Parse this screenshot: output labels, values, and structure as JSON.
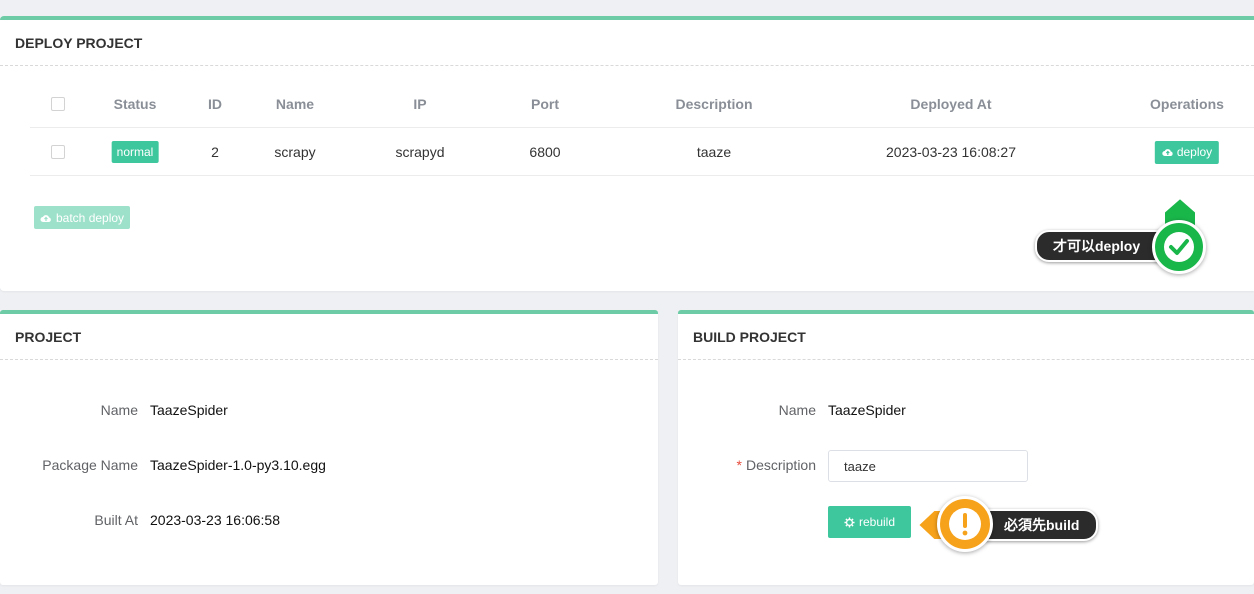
{
  "deploy_panel": {
    "title": "DEPLOY PROJECT",
    "columns": [
      "Status",
      "ID",
      "Name",
      "IP",
      "Port",
      "Description",
      "Deployed At",
      "Operations"
    ],
    "row": {
      "status": "normal",
      "id": "2",
      "name": "scrapy",
      "ip": "scrapyd",
      "port": "6800",
      "description": "taaze",
      "deployed_at": "2023-03-23 16:08:27",
      "operation_label": "deploy"
    },
    "batch_deploy_label": "batch deploy",
    "callout_text": "才可以deploy"
  },
  "project_panel": {
    "title": "PROJECT",
    "fields": [
      {
        "label": "Name",
        "value": "TaazeSpider"
      },
      {
        "label": "Package Name",
        "value": "TaazeSpider-1.0-py3.10.egg"
      },
      {
        "label": "Built At",
        "value": "2023-03-23 16:06:58"
      }
    ]
  },
  "build_panel": {
    "title": "BUILD PROJECT",
    "name_label": "Name",
    "name_value": "TaazeSpider",
    "required_mark": "*",
    "description_label": "Description",
    "description_value": "taaze",
    "rebuild_label": "rebuild",
    "callout_text": "必須先build"
  },
  "colors": {
    "accent": "#3ec69d",
    "panel_top_border": "#6dcba6",
    "callout_green": "#19b64a",
    "callout_orange": "#f7a21b",
    "callout_dark": "#2b2b2b"
  },
  "icons": {
    "deploy_button": "cloud-upload-icon",
    "batch_deploy_button": "cloud-upload-icon",
    "rebuild_button": "gear-icon",
    "deploy_callout": "check-icon",
    "build_callout": "exclamation-icon"
  }
}
